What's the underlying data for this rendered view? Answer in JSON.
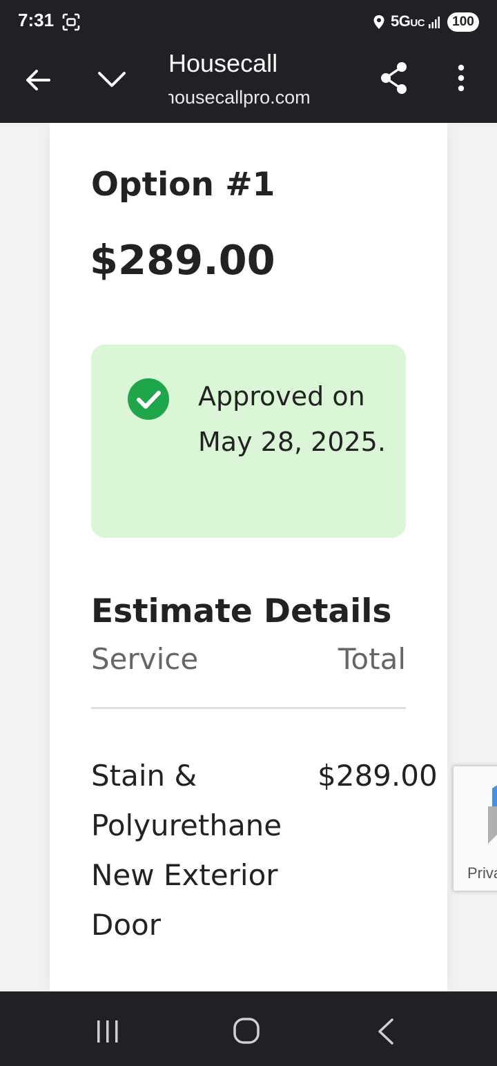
{
  "status_bar": {
    "time": "7:31",
    "network": "5G",
    "network_suffix": "UC",
    "battery": "100",
    "icons": [
      "screenshot-icon",
      "location-icon",
      "signal-icon",
      "battery-icon"
    ]
  },
  "browser_toolbar": {
    "title": "Housecall",
    "url": "housecallpro.com",
    "icons": [
      "back-arrow-icon",
      "chevron-down-icon",
      "share-icon",
      "more-vert-icon"
    ]
  },
  "estimate": {
    "option_title": "Option #1",
    "price": "$289.00",
    "approval": {
      "text": "Approved on May 28, 2025.",
      "icon": "check-circle-icon",
      "background_color": "#dbf6d7",
      "icon_color": "#1fa64a"
    },
    "details_title": "Estimate Details",
    "columns": {
      "service": "Service",
      "total": "Total"
    },
    "line_items": [
      {
        "service": "Stain & Polyurethane New Exterior Door",
        "total": "$289.00"
      }
    ]
  },
  "recaptcha_badge": {
    "text": "Privacy - Terms"
  },
  "nav_bar": {
    "icons": [
      "recents-icon",
      "home-icon",
      "back-icon"
    ]
  },
  "colors": {
    "chrome_dark": "#202124",
    "text_primary": "#222222",
    "text_secondary": "#666666",
    "success_green": "#1fa64a"
  }
}
